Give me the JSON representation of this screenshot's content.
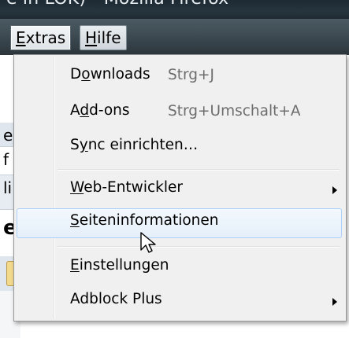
{
  "window": {
    "title": "e in LOK) - Mozilla Firefox"
  },
  "menubar": {
    "extras": {
      "label_underlined": "E",
      "label_rest": "xtras"
    },
    "hilfe": {
      "label_underlined": "H",
      "label_rest": "ilfe"
    }
  },
  "page_slices": [
    "e",
    "f",
    "li",
    "e.",
    "",
    ""
  ],
  "menu": {
    "items": [
      {
        "pre": "D",
        "u": "o",
        "post": "wnloads",
        "shortcut": "Strg+J"
      },
      {
        "pre": "A",
        "u": "d",
        "post": "d-ons",
        "shortcut": "Strg+Umschalt+A"
      },
      {
        "pre": "S",
        "u": "y",
        "post": "nc einrichten…"
      },
      {
        "pre": "",
        "u": "W",
        "post": "eb-Entwickler",
        "submenu": true
      },
      {
        "pre": "",
        "u": "S",
        "post": "eiteninformationen"
      },
      {
        "pre": "",
        "u": "E",
        "post": "instellungen"
      },
      {
        "pre": "",
        "u": "",
        "post": "Adblock Plus",
        "submenu": true
      }
    ]
  },
  "colors": {
    "titlebar": "#1f2a31",
    "menubar": "#3e4b53",
    "menu_bg": "#f0f0f0",
    "highlight_border": "#aecff7"
  }
}
